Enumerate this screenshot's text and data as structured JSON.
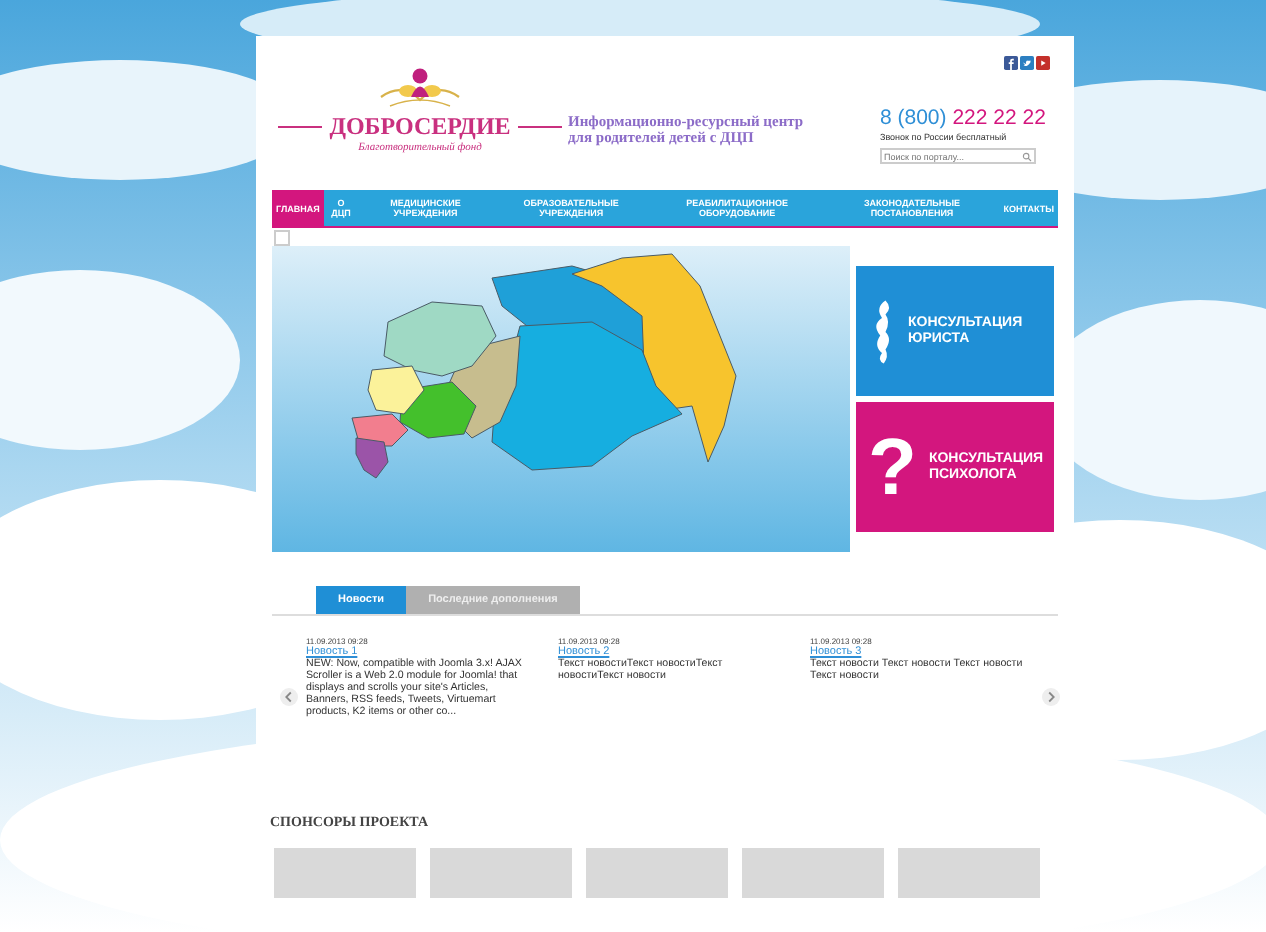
{
  "logo": {
    "title": "ДОБРОСЕРДИЕ",
    "subtitle": "Благотворительный фонд"
  },
  "tagline": "Информационно-ресурсный центр для родителей детей с ДЦП",
  "phone": {
    "prefix": "8 (800)",
    "number": "222 22 22",
    "note": "Звонок по России бесплатный"
  },
  "search": {
    "placeholder": "Поиск по порталу..."
  },
  "nav": [
    {
      "label": "ГЛАВНАЯ",
      "selected": true
    },
    {
      "label": "О ДЦП",
      "selected": false
    },
    {
      "label": "МЕДИЦИНСКИЕ УЧРЕЖДЕНИЯ",
      "selected": false
    },
    {
      "label": "ОБРАЗОВАТЕЛЬНЫЕ УЧРЕЖДЕНИЯ",
      "selected": false
    },
    {
      "label": "РЕАБИЛИТАЦИОННОЕ ОБОРУДОВАНИЕ",
      "selected": false
    },
    {
      "label": "ЗАКОНОДАТЕЛЬНЫЕ ПОСТАНОВЛЕНИЯ",
      "selected": false
    },
    {
      "label": "КОНТАКТЫ",
      "selected": false
    }
  ],
  "banners": [
    {
      "kind": "lawyer",
      "title": "КОНСУЛЬТАЦИЯ ЮРИСТА",
      "color": "#1f8fd6"
    },
    {
      "kind": "psychologist",
      "glyph": "?",
      "title": "КОНСУЛЬТАЦИЯ ПСИХОЛОГА",
      "color": "#d3167e"
    }
  ],
  "tabs": [
    {
      "label": "Новости",
      "selected": true
    },
    {
      "label": "Последние дополнения",
      "selected": false
    }
  ],
  "news": [
    {
      "date": "11.09.2013 09:28",
      "title": "Новость 1",
      "text": "NEW: Now, compatible with Joomla 3.x! AJAX Scroller is a Web 2.0 module for Joomla! that displays and scrolls your site's Articles, Banners, RSS feeds, Tweets, Virtuemart products, K2 items or other co..."
    },
    {
      "date": "11.09.2013 09:28",
      "title": "Новость 2",
      "text": "Текст новостиТекст новостиТекст новостиТекст новости"
    },
    {
      "date": "11.09.2013 09:28",
      "title": "Новость 3",
      "text": "Текст новости Текст новости Текст новости Текст новости"
    }
  ],
  "sponsors": {
    "title": "СПОНСОРЫ ПРОЕКТА",
    "logos": [
      {
        "kind": "placeholder"
      },
      {
        "kind": "placeholder"
      },
      {
        "kind": "placeholder"
      },
      {
        "kind": "placeholder"
      },
      {
        "kind": "placeholder"
      }
    ]
  }
}
